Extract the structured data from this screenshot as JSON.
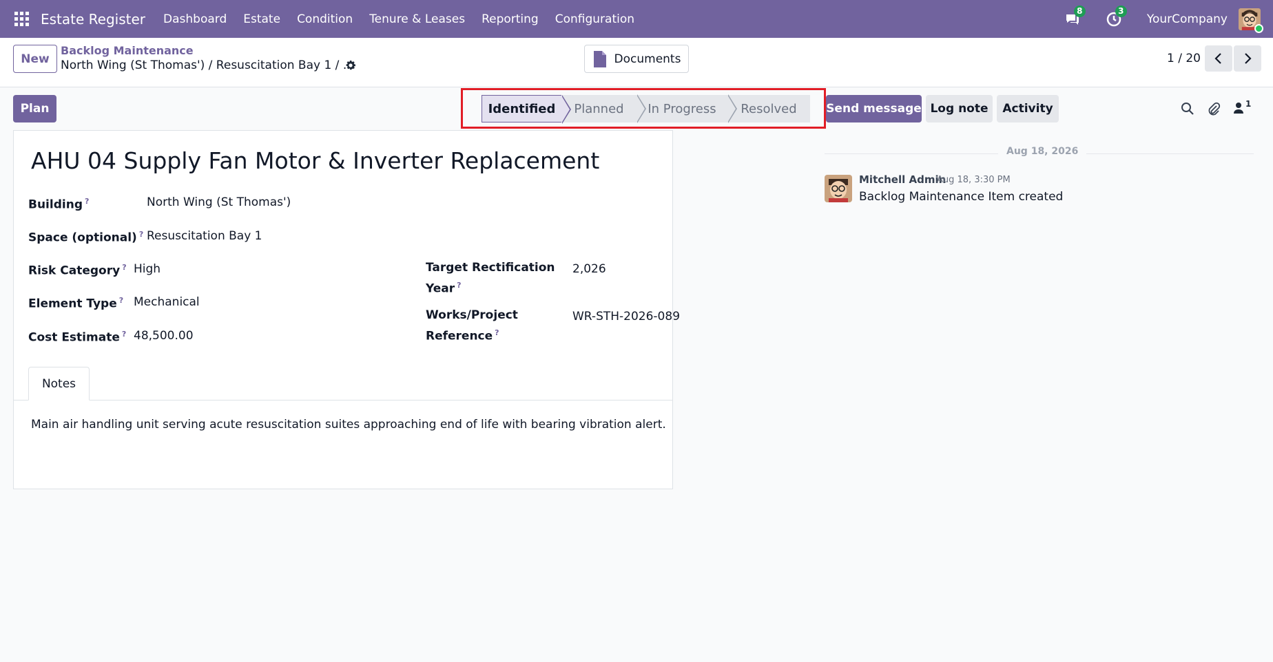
{
  "navbar": {
    "app_name": "Estate Register",
    "menu": [
      "Dashboard",
      "Estate",
      "Condition",
      "Tenure & Leases",
      "Reporting",
      "Configuration"
    ],
    "messages_badge": "8",
    "activities_badge": "3",
    "company": "YourCompany"
  },
  "control_panel": {
    "new_label": "New",
    "breadcrumb_parent": "Backlog Maintenance",
    "breadcrumb_current": "North Wing (St Thomas') / Resuscitation Bay 1 / ...",
    "documents_label": "Documents",
    "pager": "1 / 20"
  },
  "statusbar": {
    "plan_label": "Plan",
    "stages": [
      "Identified",
      "Planned",
      "In Progress",
      "Resolved"
    ],
    "active_stage": "Identified"
  },
  "form": {
    "title": "AHU 04 Supply Fan Motor & Inverter Replacement",
    "help_mark": "?",
    "fields": {
      "building": {
        "label": "Building",
        "value": "North Wing (St Thomas')"
      },
      "space": {
        "label": "Space (optional)",
        "value": "Resuscitation Bay 1"
      },
      "risk_category": {
        "label": "Risk Category",
        "value": "High"
      },
      "element_type": {
        "label": "Element Type",
        "value": "Mechanical"
      },
      "cost_estimate": {
        "label": "Cost Estimate",
        "value": "48,500.00"
      },
      "target_year": {
        "label_line1": "Target Rectification",
        "label_line2": "Year",
        "value": "2,026"
      },
      "works_ref": {
        "label_line1": "Works/Project",
        "label_line2": "Reference",
        "value": "WR-STH-2026-089"
      }
    },
    "tabs": {
      "notes_label": "Notes"
    },
    "notes": "Main air handling unit serving acute resuscitation suites approaching end of life with bearing vibration alert."
  },
  "chatter": {
    "send_label": "Send message",
    "log_label": "Log note",
    "activity_label": "Activity",
    "followers_count": "1",
    "date_separator": "Aug 18, 2026",
    "messages": [
      {
        "author": "Mitchell Admin",
        "date": "Aug 18, 3:30 PM",
        "body": "Backlog Maintenance Item created"
      }
    ]
  },
  "colors": {
    "brand": "#71639e",
    "badge": "#1f9d55",
    "highlight": "#e11d26"
  }
}
